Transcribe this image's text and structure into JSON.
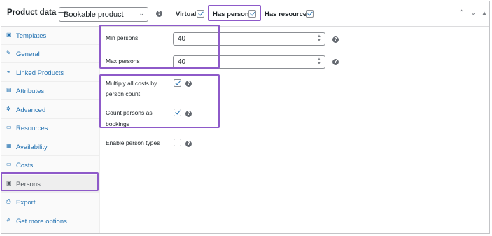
{
  "header": {
    "title": "Product data —",
    "product_type": "Bookable product",
    "virtual_label": "Virtual:",
    "virtual_checked": true,
    "has_persons_label": "Has persons:",
    "has_persons_checked": true,
    "has_resources_label": "Has resources:",
    "has_resources_checked": true
  },
  "sidebar": {
    "items": [
      {
        "label": "Templates",
        "icon": "templates-icon",
        "glyph": "▣"
      },
      {
        "label": "General",
        "icon": "wrench-icon",
        "glyph": "✎"
      },
      {
        "label": "Linked Products",
        "icon": "link-icon",
        "glyph": "⚭"
      },
      {
        "label": "Attributes",
        "icon": "attributes-icon",
        "glyph": "▤"
      },
      {
        "label": "Advanced",
        "icon": "gear-icon",
        "glyph": "✲"
      },
      {
        "label": "Resources",
        "icon": "resources-icon",
        "glyph": "▭"
      },
      {
        "label": "Availability",
        "icon": "calendar-icon",
        "glyph": "▦"
      },
      {
        "label": "Costs",
        "icon": "costs-icon",
        "glyph": "▭"
      },
      {
        "label": "Persons",
        "icon": "persons-icon",
        "glyph": "▣",
        "active": true
      },
      {
        "label": "Export",
        "icon": "export-icon",
        "glyph": "⎙"
      },
      {
        "label": "Get more options",
        "icon": "plugin-icon",
        "glyph": "✐"
      }
    ]
  },
  "persons": {
    "min_label": "Min persons",
    "min_value": "40",
    "max_label": "Max persons",
    "max_value": "40",
    "multiply_label_1": "Multiply all costs by",
    "multiply_label_2": "person count",
    "multiply_checked": true,
    "count_label_1": "Count persons as",
    "count_label_2": "bookings",
    "count_checked": true,
    "enable_types_label": "Enable person types",
    "enable_types_checked": false
  },
  "colors": {
    "highlight": "#8e5ac9",
    "link": "#2271b1"
  }
}
